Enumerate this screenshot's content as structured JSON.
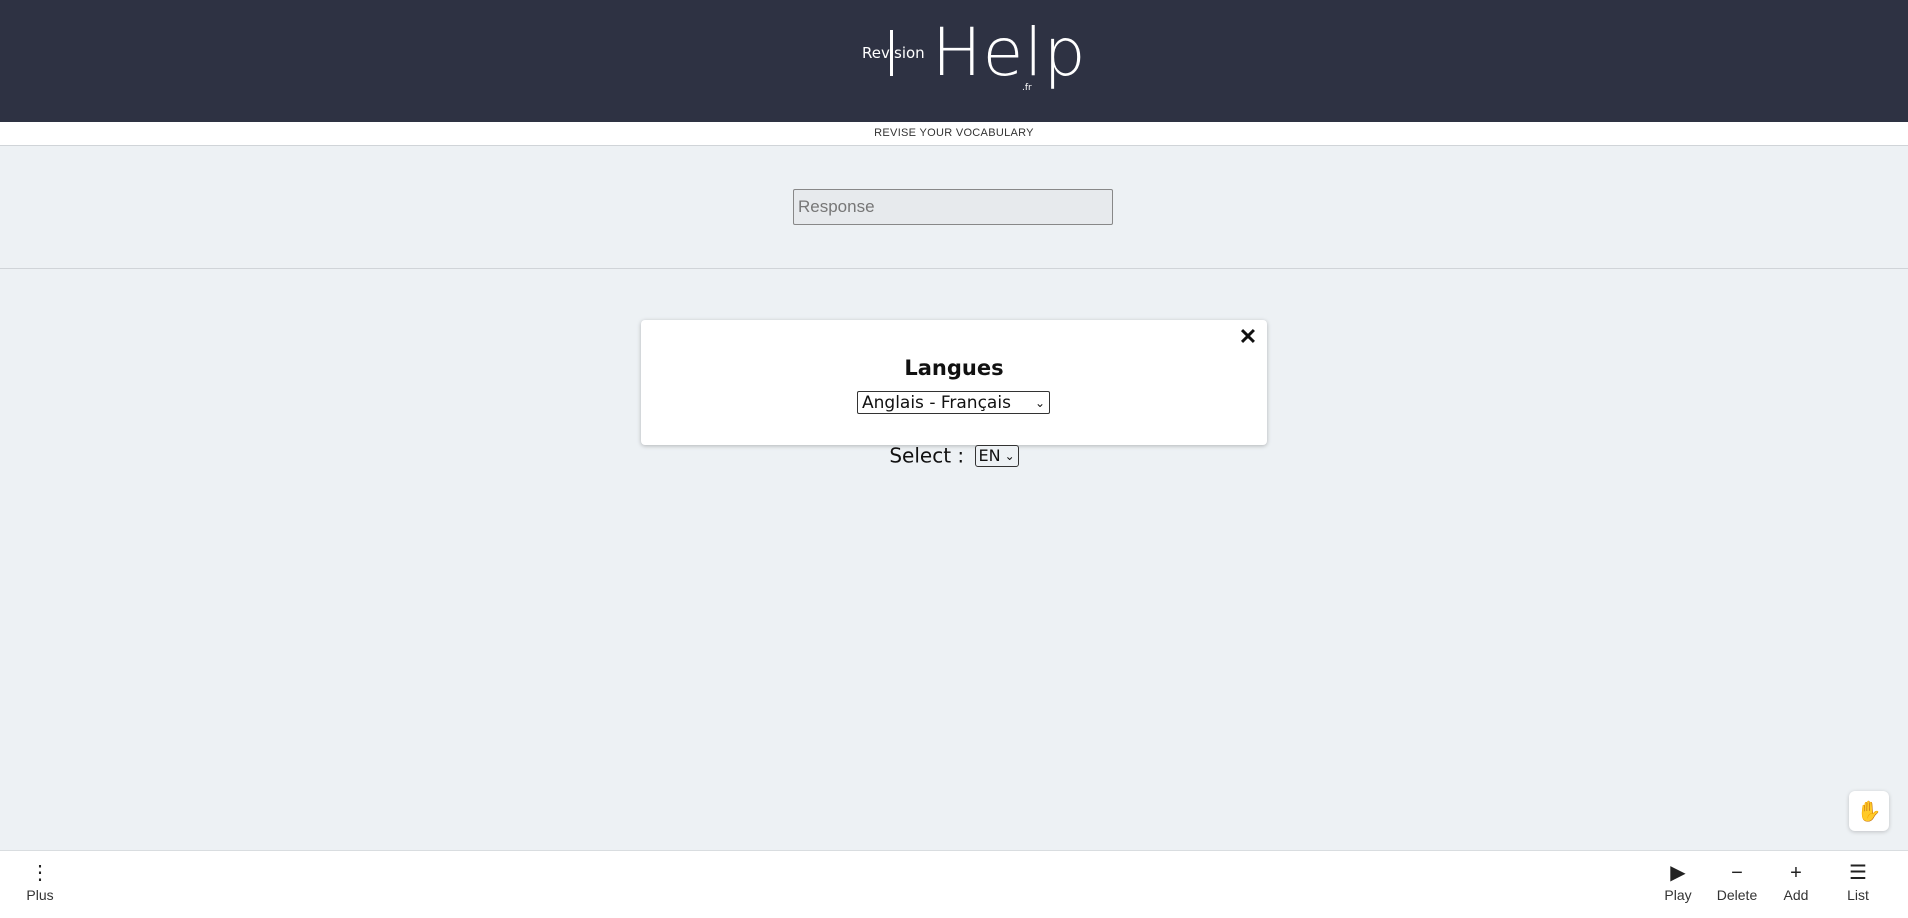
{
  "header": {
    "logo_small": "Revision",
    "logo_big": "Help",
    "logo_tld": ".fr"
  },
  "subtitle": "REVISE YOUR VOCABULARY",
  "response": {
    "placeholder": "Response",
    "value": ""
  },
  "modal": {
    "close_icon": "close-icon",
    "title": "Langues",
    "selected_language": "Anglais - Français"
  },
  "select_row": {
    "label": "Select :",
    "value": "EN"
  },
  "help_fab": {
    "icon": "hand-icon"
  },
  "bottom_nav": {
    "plus_label": "Plus",
    "play_label": "Play",
    "delete_label": "Delete",
    "add_label": "Add",
    "list_label": "List"
  },
  "colors": {
    "header_bg": "#2e3243",
    "page_bg": "#edf1f4"
  }
}
